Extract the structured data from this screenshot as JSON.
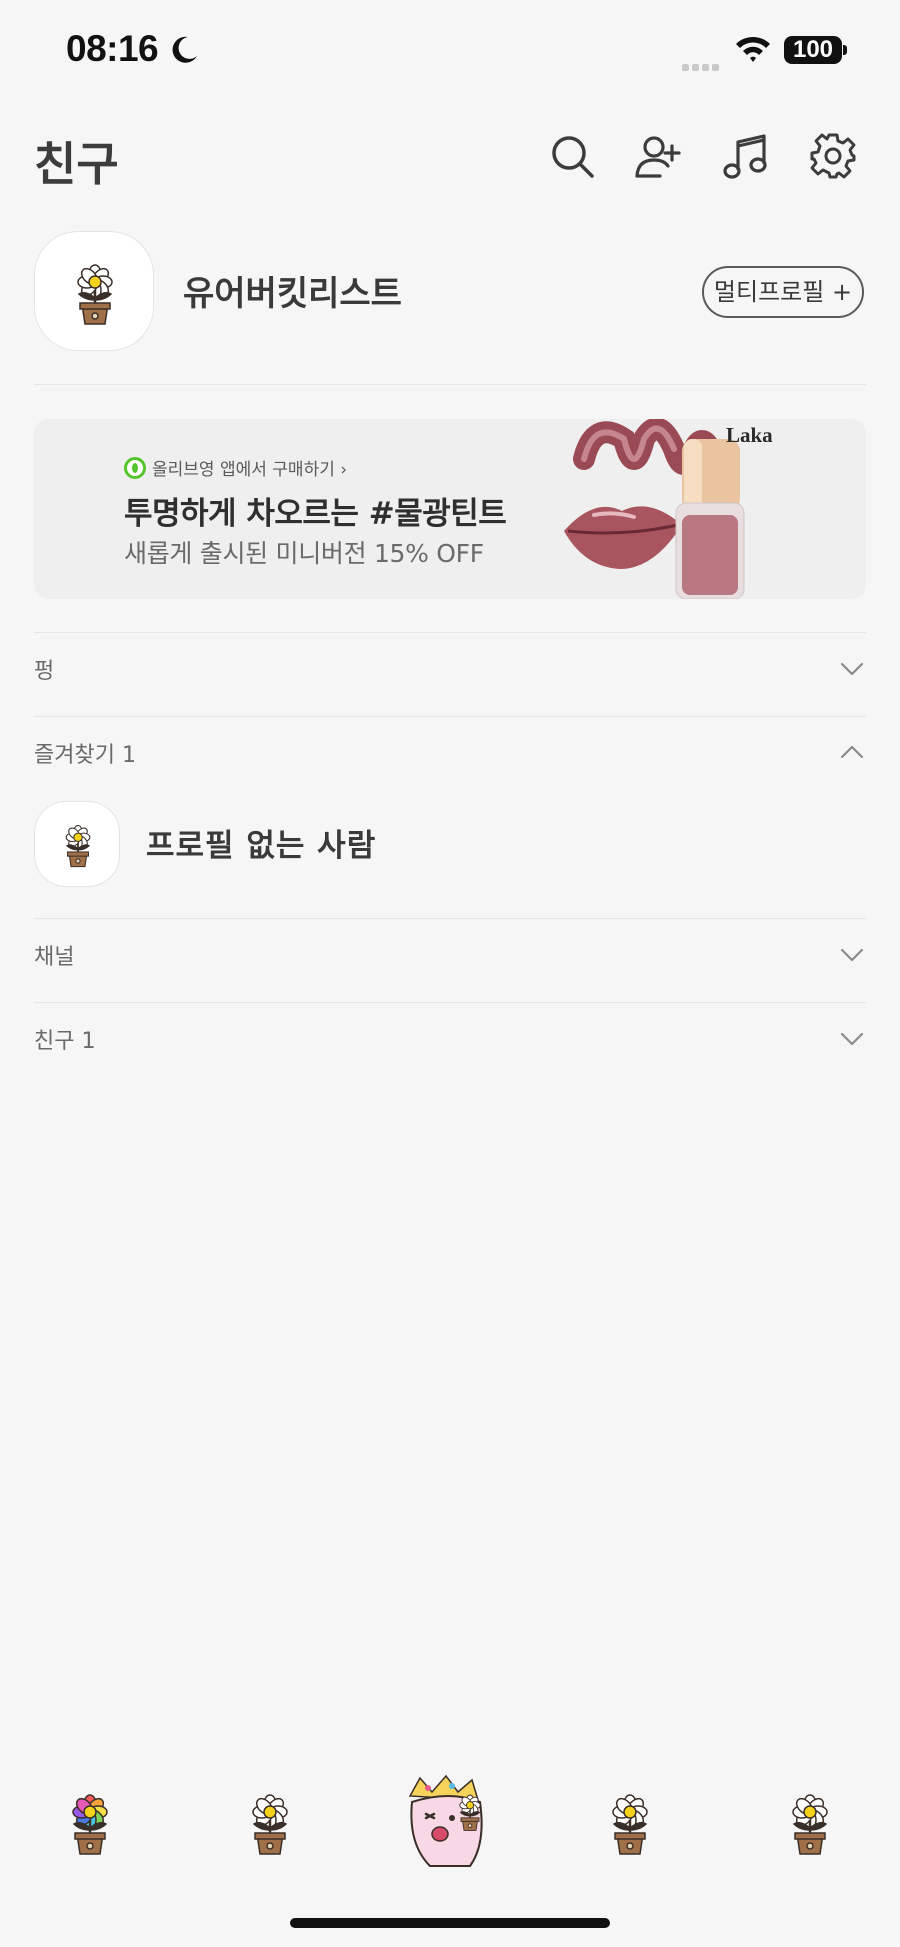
{
  "status_bar": {
    "time": "08:16",
    "battery": "100"
  },
  "header": {
    "title": "친구"
  },
  "my_profile": {
    "name": "유어버킷리스트",
    "multi_profile_button": "멀티프로필 +"
  },
  "ad": {
    "source": "올리브영 앱에서 구매하기",
    "title": "투명하게 차오르는 #물광틴트",
    "subtitle": "새롭게 출시된 미니버전 15% OFF",
    "brand": "Laka"
  },
  "sections": [
    {
      "label": "펑",
      "state": "collapsed"
    },
    {
      "label": "즐겨찾기 1",
      "state": "expanded"
    },
    {
      "label": "채널",
      "state": "collapsed"
    },
    {
      "label": "친구 1",
      "state": "collapsed"
    }
  ],
  "favorites": [
    {
      "name": "프로필 없는 사람"
    }
  ],
  "tabs": [
    {
      "name": "friends-tab",
      "icon": "rainbow-flower-pot-icon"
    },
    {
      "name": "chats-tab",
      "icon": "flower-pot-icon"
    },
    {
      "name": "center-tab",
      "icon": "character-icon"
    },
    {
      "name": "shopping-tab",
      "icon": "flower-pot-icon"
    },
    {
      "name": "more-tab",
      "icon": "flower-pot-icon"
    }
  ]
}
